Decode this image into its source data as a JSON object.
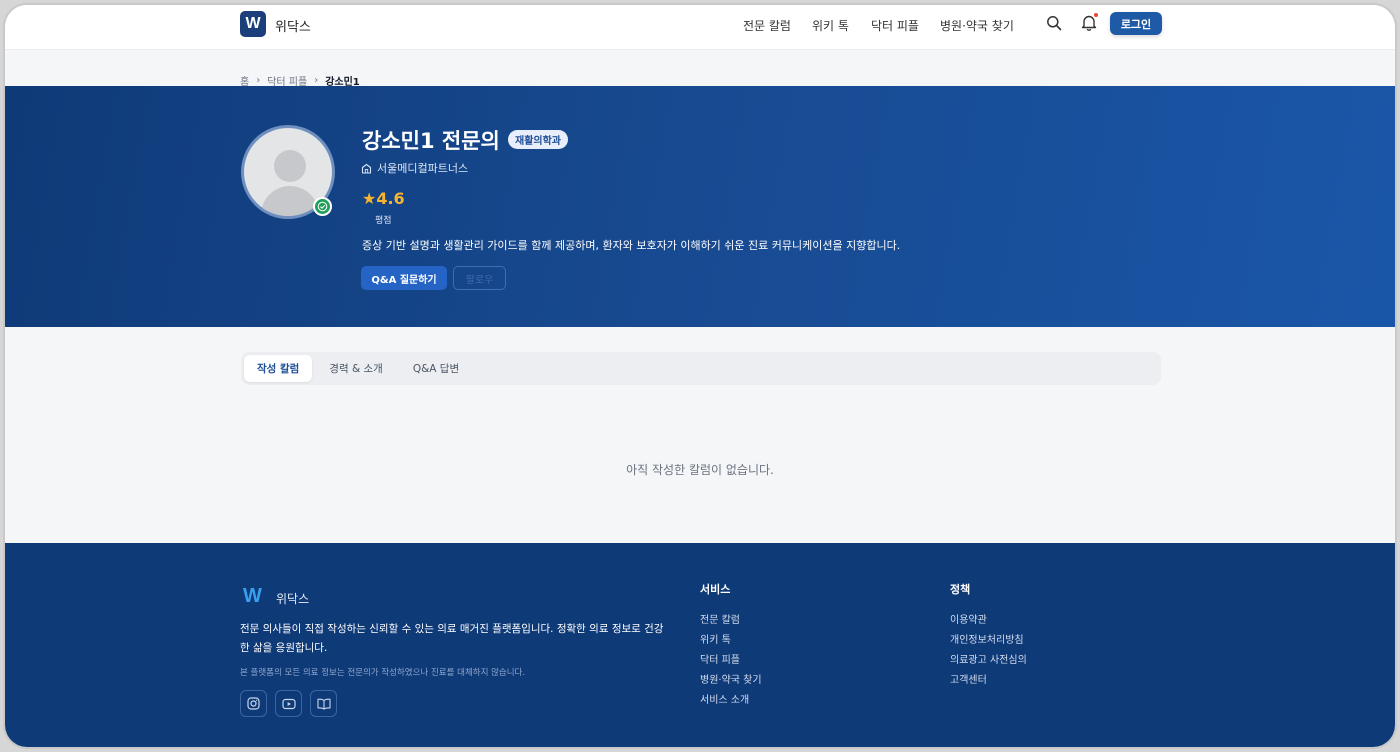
{
  "header": {
    "brand": "위닥스",
    "nav": [
      "전문 칼럼",
      "위키 톡",
      "닥터 피플",
      "병원·약국 찾기"
    ],
    "login_label": "로그인"
  },
  "breadcrumb": {
    "items": [
      "홈",
      "닥터 피플",
      "강소민1"
    ],
    "separator": "›"
  },
  "profile": {
    "name": "강소민1 전문의",
    "specialty": "재활의학과",
    "hospital": "서울메디컬파트너스",
    "rating_star": "★",
    "rating_value": "4.6",
    "rating_label": "평점",
    "intro": "증상 기반 설명과 생활관리 가이드를 함께 제공하며, 환자와 보호자가 이해하기 쉬운 진료 커뮤니케이션을 지향합니다.",
    "qa_button": "Q&A 질문하기",
    "follow_button": "팔로우"
  },
  "tabs": [
    {
      "label": "작성 칼럼",
      "active": true
    },
    {
      "label": "경력 & 소개",
      "active": false
    },
    {
      "label": "Q&A 답변",
      "active": false
    }
  ],
  "empty_message": "아직 작성한 칼럼이 없습니다.",
  "footer": {
    "logo_letter": "W",
    "brand": "위닥스",
    "description": "전문 의사들이 직접 작성하는 신뢰할 수 있는 의료 매거진 플랫폼입니다. 정확한 의료 정보로 건강한 삶을 응원합니다.",
    "note": "본 플랫폼의 모든 의료 정보는 전문의가 작성하였으나 진료를 대체하지 않습니다.",
    "service_title": "서비스",
    "service_links": [
      "전문 칼럼",
      "위키 톡",
      "닥터 피플",
      "병원·약국 찾기",
      "서비스 소개"
    ],
    "policy_title": "정책",
    "policy_links": [
      "이용약관",
      "개인정보처리방침",
      "의료광고 사전심의",
      "고객센터"
    ]
  },
  "colors": {
    "brand_navy": "#0f3a78",
    "primary_blue": "#2563c4",
    "rating_gold": "#f8b431",
    "online_green": "#22a05b"
  }
}
